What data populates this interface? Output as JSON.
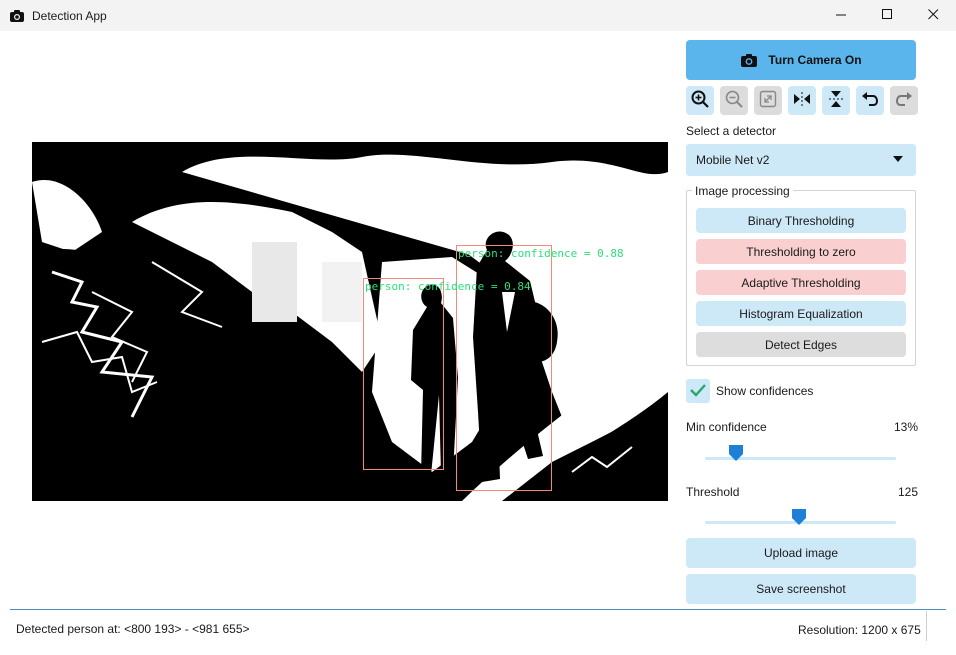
{
  "window": {
    "title": "Detection App",
    "icon": "camera-icon",
    "controls": [
      "minimize-icon",
      "maximize-icon",
      "close-icon"
    ]
  },
  "viewer": {
    "detections": [
      {
        "label": "person: confidence = 0.84"
      },
      {
        "label": "person: confidence = 0.88"
      }
    ]
  },
  "camera_button": {
    "label": "Turn Camera On",
    "icon": "camera-icon"
  },
  "toolbar": {
    "tools": [
      {
        "icon": "zoom-in-icon",
        "state": "enabled"
      },
      {
        "icon": "zoom-out-icon",
        "state": "disabled"
      },
      {
        "icon": "fit-to-screen-icon",
        "state": "disabled"
      },
      {
        "icon": "flip-horizontal-icon",
        "state": "enabled"
      },
      {
        "icon": "flip-vertical-icon",
        "state": "enabled"
      },
      {
        "icon": "undo-icon",
        "state": "enabled"
      },
      {
        "icon": "redo-icon",
        "state": "disabled"
      }
    ]
  },
  "detector": {
    "label": "Select a detector",
    "selected": "Mobile Net v2"
  },
  "image_processing": {
    "title": "Image processing",
    "buttons": [
      {
        "label": "Binary Thresholding",
        "state": "on",
        "color": "#cde8f7"
      },
      {
        "label": "Thresholding to zero",
        "state": "off",
        "color": "#f9cfd0"
      },
      {
        "label": "Adaptive Thresholding",
        "state": "off",
        "color": "#f9cfd0"
      },
      {
        "label": "Histogram Equalization",
        "state": "on",
        "color": "#cde8f7"
      },
      {
        "label": "Detect Edges",
        "state": "disabled",
        "color": "#dddddd"
      }
    ]
  },
  "show_confidences": {
    "label": "Show confidences",
    "checked": true
  },
  "min_confidence": {
    "label": "Min confidence",
    "value_text": "13%",
    "value": 0.13
  },
  "threshold": {
    "label": "Threshold",
    "value_text": "125",
    "value": 125,
    "max": 255
  },
  "actions": {
    "upload": "Upload image",
    "save": "Save screenshot"
  },
  "status": {
    "detected": "Detected person at: <800 193> - <981 655>",
    "resolution": "Resolution: 1200 x 675"
  },
  "colors": {
    "accent": "#5ab5ec",
    "light_blue": "#cde8f7",
    "pink": "#f9cfd0",
    "detection_text": "#29e07a",
    "detection_box": "#f28a7a"
  }
}
